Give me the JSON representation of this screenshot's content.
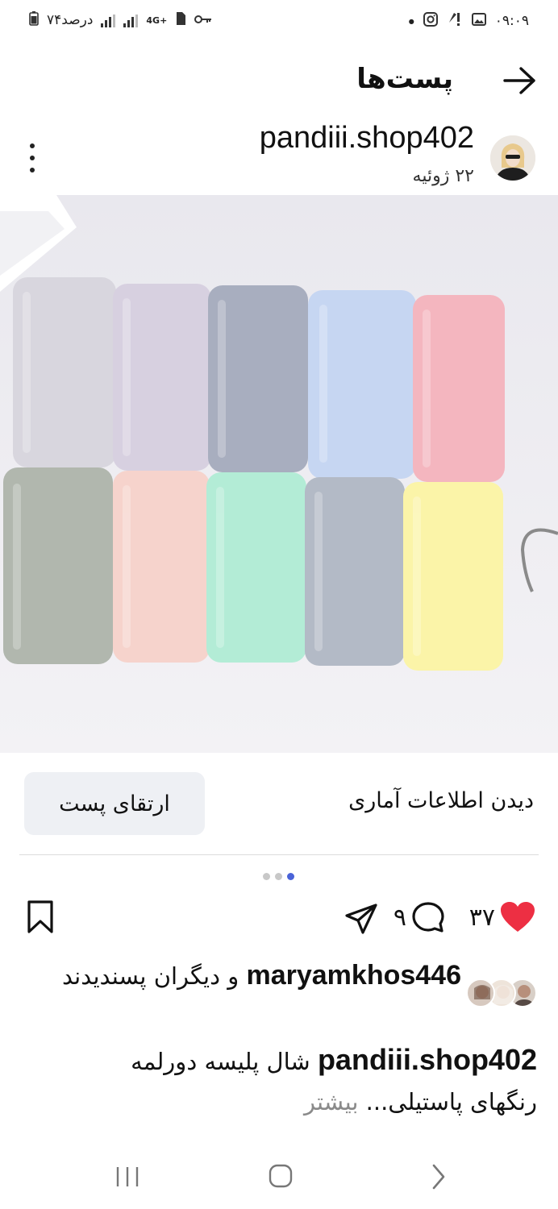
{
  "status_bar": {
    "time": "۰۹:۰۹",
    "battery_text": "۷۴درصد",
    "network_label": "4G+"
  },
  "header": {
    "title": "پست‌ها",
    "back_icon": "arrow-right-icon"
  },
  "post": {
    "username": "pandiii.shop402",
    "date": "۲۲ ژوئیه",
    "image_description_icon": "photo"
  },
  "actions": {
    "view_insights": "دیدن اطلاعات آماری",
    "boost_post": "ارتقای پست"
  },
  "carousel": {
    "count": 3,
    "active_index": 2
  },
  "engagement": {
    "like_count": "۳۷",
    "comment_count": "۹",
    "like_color": "#ed2f43"
  },
  "likes": {
    "user": "maryamkhos446",
    "others_text": "و دیگران",
    "liked_text": "پسندیدند"
  },
  "caption": {
    "username": "pandiii.shop402",
    "text_line1": "شال پلیسه دورلمه",
    "text_line2": "رنگهای پاستیلی...",
    "more": "بیشتر"
  }
}
